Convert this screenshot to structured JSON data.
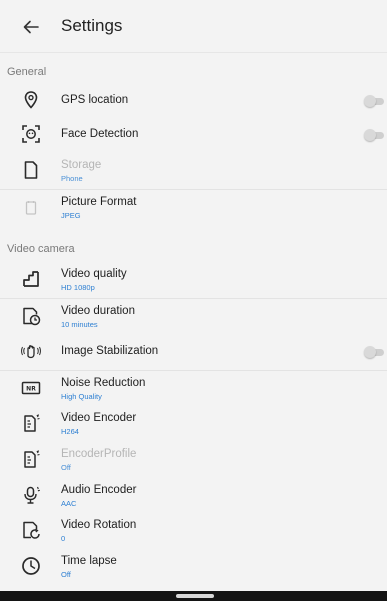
{
  "header": {
    "title": "Settings",
    "back_icon": "arrow-back-icon"
  },
  "sections": {
    "general": "General",
    "video_camera": "Video camera"
  },
  "general_items": [
    {
      "label": "GPS location",
      "icon": "location-pin-icon",
      "toggle": false
    },
    {
      "label": "Face Detection",
      "icon": "face-detection-icon",
      "toggle": false
    },
    {
      "label": "Storage",
      "sub": "Phone",
      "icon": "storage-file-icon",
      "disabled": true
    },
    {
      "label": "Picture Format",
      "sub": "JPEG",
      "icon": "picture-format-icon"
    }
  ],
  "video_items": [
    {
      "label": "Video quality",
      "sub": "HD 1080p",
      "icon": "video-quality-icon"
    },
    {
      "label": "Video duration",
      "sub": "10 minutes",
      "icon": "video-duration-icon"
    },
    {
      "label": "Image Stabilization",
      "icon": "image-stabilization-icon",
      "toggle": false
    },
    {
      "label": "Noise Reduction",
      "sub": "High Quality",
      "icon": "noise-reduction-icon",
      "badge": "NR"
    },
    {
      "label": "Video Encoder",
      "sub": "H264",
      "icon": "video-encoder-icon"
    },
    {
      "label": "EncoderProfile",
      "sub": "Off",
      "icon": "encoder-profile-icon",
      "disabled": true
    },
    {
      "label": "Audio Encoder",
      "sub": "AAC",
      "icon": "audio-encoder-icon"
    },
    {
      "label": "Video Rotation",
      "sub": "0",
      "icon": "video-rotation-icon"
    },
    {
      "label": "Time lapse",
      "sub": "Off",
      "icon": "time-lapse-icon"
    }
  ],
  "colors": {
    "background": "#f3f3f3",
    "summary_text": "#2d7fd2",
    "section_text": "#7a7a7a",
    "switch_off": "#cfcfcf"
  }
}
